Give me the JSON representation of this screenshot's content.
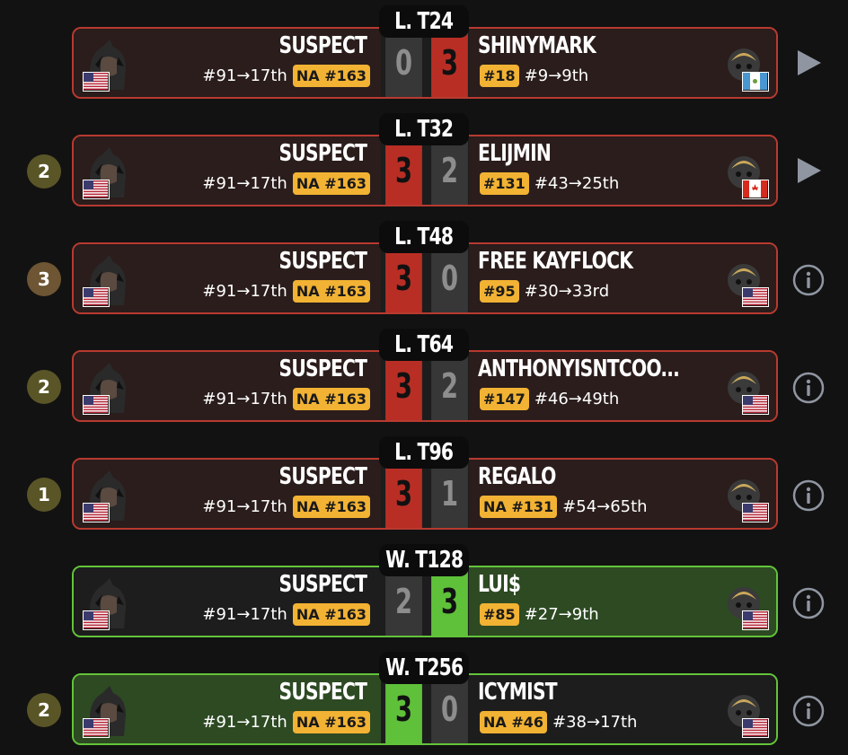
{
  "colors": {
    "loss_border": "#b83a30",
    "win_border": "#63c43a",
    "badge": "#f2b233"
  },
  "matches": [
    {
      "round": "L. T24",
      "result": "loss",
      "count": "",
      "count_color": "",
      "action": "play-icon",
      "left": {
        "name": "SUSPECT",
        "progress": "#91→17th",
        "badge": "NA #163",
        "score": "0",
        "flag": "us"
      },
      "right": {
        "name": "SHINYMARK",
        "progress": "#9→9th",
        "badge": "#18",
        "score": "3",
        "flag": "gt"
      }
    },
    {
      "round": "L. T32",
      "result": "loss",
      "count": "2",
      "count_color": "#5a5527",
      "action": "play-icon",
      "left": {
        "name": "SUSPECT",
        "progress": "#91→17th",
        "badge": "NA #163",
        "score": "3",
        "flag": "us"
      },
      "right": {
        "name": "ELIJMIN",
        "progress": "#43→25th",
        "badge": "#131",
        "score": "2",
        "flag": "ca"
      }
    },
    {
      "round": "L. T48",
      "result": "loss",
      "count": "3",
      "count_color": "#6e5533",
      "action": "info-icon",
      "left": {
        "name": "SUSPECT",
        "progress": "#91→17th",
        "badge": "NA #163",
        "score": "3",
        "flag": "us"
      },
      "right": {
        "name": "FREE KAYFLOCK",
        "progress": "#30→33rd",
        "badge": "#95",
        "score": "0",
        "flag": "us"
      }
    },
    {
      "round": "L. T64",
      "result": "loss",
      "count": "2",
      "count_color": "#5a5527",
      "action": "info-icon",
      "left": {
        "name": "SUSPECT",
        "progress": "#91→17th",
        "badge": "NA #163",
        "score": "3",
        "flag": "us"
      },
      "right": {
        "name": "ANTHONYISNTCOO...",
        "progress": "#46→49th",
        "badge": "#147",
        "score": "2",
        "flag": "us"
      }
    },
    {
      "round": "L. T96",
      "result": "loss",
      "count": "1",
      "count_color": "#5a5527",
      "action": "info-icon",
      "left": {
        "name": "SUSPECT",
        "progress": "#91→17th",
        "badge": "NA #163",
        "score": "3",
        "flag": "us"
      },
      "right": {
        "name": "REGALO",
        "progress": "#54→65th",
        "badge": "NA #131",
        "score": "1",
        "flag": "us"
      }
    },
    {
      "round": "W. T128",
      "result": "win-right",
      "count": "",
      "count_color": "",
      "action": "info-icon",
      "left": {
        "name": "SUSPECT",
        "progress": "#91→17th",
        "badge": "NA #163",
        "score": "2",
        "flag": "us"
      },
      "right": {
        "name": "LUI$",
        "progress": "#27→9th",
        "badge": "#85",
        "score": "3",
        "flag": "us"
      }
    },
    {
      "round": "W. T256",
      "result": "win-left",
      "count": "2",
      "count_color": "#5a5527",
      "action": "info-icon",
      "left": {
        "name": "SUSPECT",
        "progress": "#91→17th",
        "badge": "NA #163",
        "score": "3",
        "flag": "us"
      },
      "right": {
        "name": "ICYMIST",
        "progress": "#38→17th",
        "badge": "NA #46",
        "score": "0",
        "flag": "us"
      }
    }
  ]
}
